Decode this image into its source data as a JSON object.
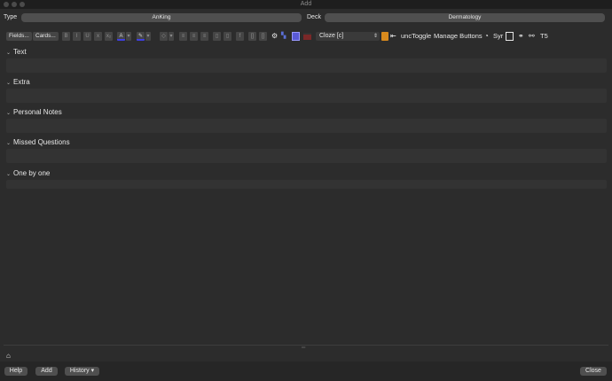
{
  "window": {
    "title": "Add"
  },
  "type_row": {
    "type_label": "Type",
    "type_value": "AnKing",
    "deck_label": "Deck",
    "deck_value": "Dermatology"
  },
  "toolbar": {
    "fields_label": "Fields...",
    "cards_label": "Cards...",
    "format_icons": [
      "B",
      "I",
      "U",
      "x",
      "x₂",
      "A",
      "▾",
      "✎",
      "▾",
      "◇",
      "▾",
      "≡",
      "≡",
      "≡",
      "▯",
      "▯",
      "f",
      "[]",
      "[]"
    ],
    "notetype_value": "Cloze [c]",
    "addon_labels": [
      "uncToggle",
      "Manage Buttons",
      "Syr",
      "T5"
    ],
    "colors": {
      "highlight_icon": "#5a5ad6",
      "edit_icon": "#d98a1d",
      "accent_swatch": "#7a2828"
    }
  },
  "fields": [
    {
      "label": "Text"
    },
    {
      "label": "Extra"
    },
    {
      "label": "Personal Notes"
    },
    {
      "label": "Missed Questions"
    },
    {
      "label": "One by one"
    }
  ],
  "bottom": {
    "help_label": "Help",
    "add_label": "Add",
    "history_label": "History ▾",
    "close_label": "Close"
  }
}
